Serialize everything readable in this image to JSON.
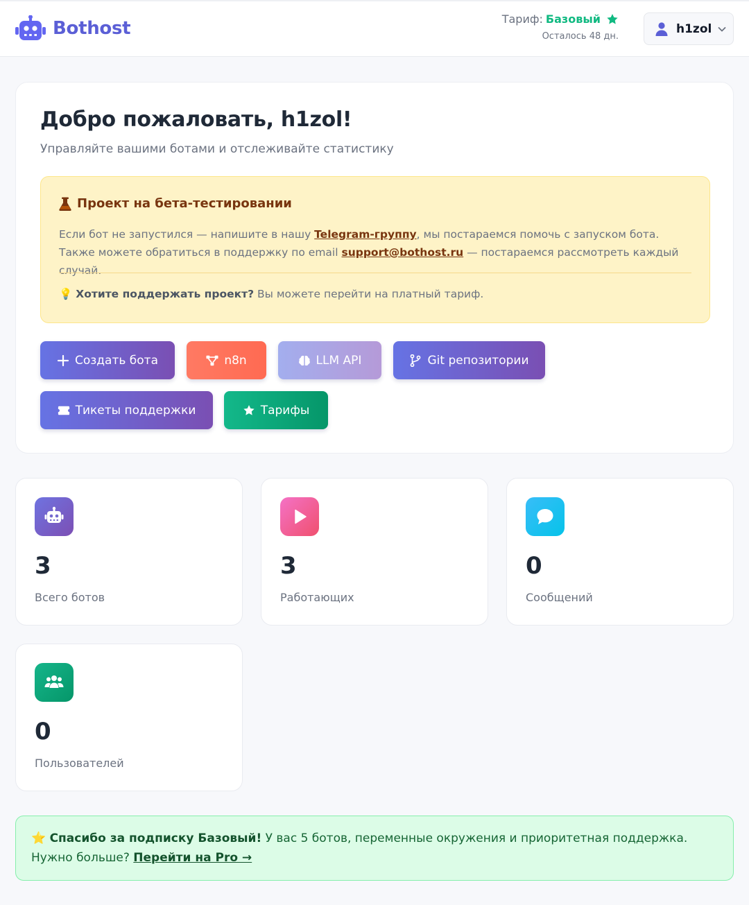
{
  "header": {
    "brand": "Bothost",
    "plan_label": "Тариф:",
    "plan_name": "Базовый",
    "plan_days": "Осталось 48 дн.",
    "username": "h1zol"
  },
  "welcome": {
    "title": "Добро пожаловать, h1zol!",
    "subtitle": "Управляйте вашими ботами и отслеживайте статистику"
  },
  "beta": {
    "title": "Проект на бета-тестировании",
    "text_1": "Если бот не запустился — напишите в нашу ",
    "telegram_link": "Telegram-группу",
    "text_2": ", мы постараемся помочь с запуском бота. Также можете обратиться в поддержку по email ",
    "email_link": "support@bothost.ru",
    "text_3": " — постараемся рассмотреть каждый случай.",
    "support_icon": "💡",
    "support_bold": "Хотите поддержать проект?",
    "support_text": " Вы можете перейти на платный тариф."
  },
  "actions": {
    "create_bot": "Создать бота",
    "n8n": "n8n",
    "llm_api": "LLM API",
    "git": "Git репозитории",
    "tickets": "Тикеты поддержки",
    "tariffs": "Тарифы"
  },
  "stats": [
    {
      "value": "3",
      "label": "Всего ботов",
      "icon": "robot-icon"
    },
    {
      "value": "3",
      "label": "Работающих",
      "icon": "play-icon"
    },
    {
      "value": "0",
      "label": "Сообщений",
      "icon": "chat-icon"
    },
    {
      "value": "0",
      "label": "Пользователей",
      "icon": "users-icon"
    }
  ],
  "thanks": {
    "icon": "⭐",
    "bold": "Спасибо за подписку Базовый!",
    "text": " У вас 5 ботов, переменные окружения и приоритетная поддержка. Нужно больше? ",
    "link": "Перейти на Pro →"
  },
  "colors": {
    "brand": "#5b5fd6",
    "plan_green": "#10b981",
    "beta_bg": "#fef3c7",
    "thanks_bg": "#dcfce7"
  }
}
